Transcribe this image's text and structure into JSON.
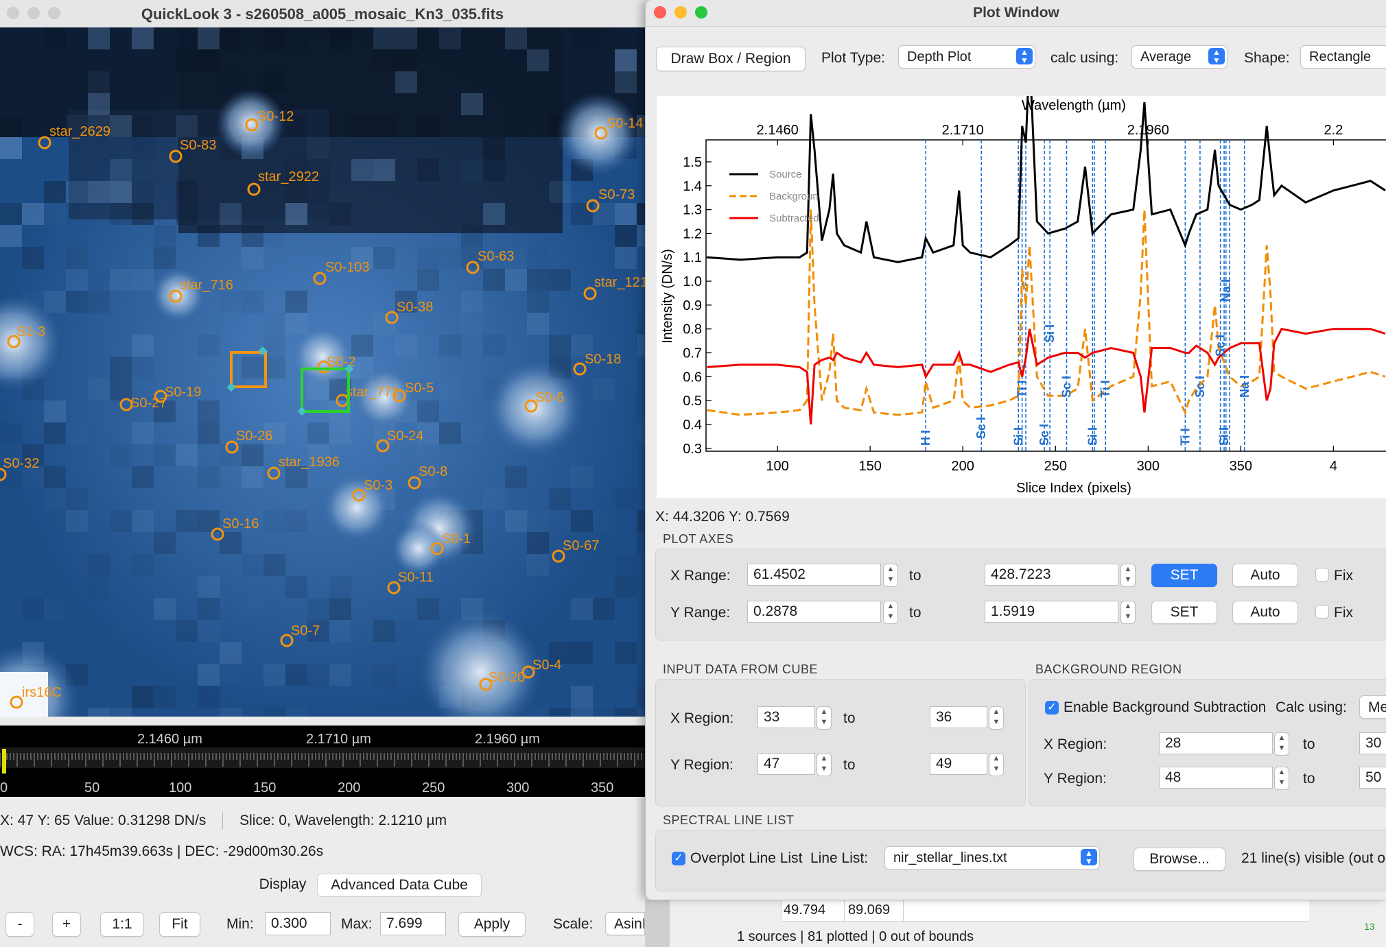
{
  "quicklook": {
    "title": "QuickLook 3 - s260508_a005_mosaic_Kn3_035.fits",
    "catalog": [
      {
        "label": "S0-12"
      },
      {
        "label": "star_2629"
      },
      {
        "label": "S0-83"
      },
      {
        "label": "star_2922"
      },
      {
        "label": "S0-14"
      },
      {
        "label": "S0-73"
      },
      {
        "label": "S0-63"
      },
      {
        "label": "S0-103"
      },
      {
        "label": "star_716"
      },
      {
        "label": "star_121"
      },
      {
        "label": "S0-38"
      },
      {
        "label": "S1-3"
      },
      {
        "label": "S0-2"
      },
      {
        "label": "S0-18"
      },
      {
        "label": "S0-27"
      },
      {
        "label": "S0-19"
      },
      {
        "label": "star_771"
      },
      {
        "label": "S0-5"
      },
      {
        "label": "S0-6"
      },
      {
        "label": "S0-26"
      },
      {
        "label": "S0-24"
      },
      {
        "label": "S0-32"
      },
      {
        "label": "star_1936"
      },
      {
        "label": "S0-8"
      },
      {
        "label": "S0-3"
      },
      {
        "label": "S0-16"
      },
      {
        "label": "S0-1"
      },
      {
        "label": "S0-67"
      },
      {
        "label": "S0-11"
      },
      {
        "label": "S0-7"
      },
      {
        "label": "S0-4"
      },
      {
        "label": "S0-20"
      },
      {
        "label": "irs16C"
      }
    ],
    "wavelength_strip": {
      "top_ticks": [
        "2.1460 µm",
        "2.1710 µm",
        "2.1960 µm"
      ],
      "bottom_ticks": [
        "0",
        "50",
        "100",
        "150",
        "200",
        "250",
        "300",
        "350"
      ]
    },
    "status": {
      "cursor": "X: 47  Y: 65  Value: 0.31298 DN/s",
      "slice": "Slice: 0, Wavelength: 2.1210 µm",
      "wcs": "WCS: RA: 17h45m39.663s  |  DEC: -29d00m30.26s"
    },
    "tabs": {
      "display": "Display",
      "advanced": "Advanced Data Cube"
    },
    "controls": {
      "minus": "-",
      "plus": "+",
      "one_to_one": "1:1",
      "fit": "Fit",
      "min_label": "Min:",
      "min_value": "0.300",
      "max_label": "Max:",
      "max_value": "7.699",
      "apply": "Apply",
      "scale_label": "Scale:",
      "scale_value": "AsinH"
    }
  },
  "background_window": {
    "table_cells": [
      "49.794",
      "89.069"
    ],
    "footer": "1 sources | 81 plotted | 0 out of bounds",
    "corner": "13"
  },
  "plot_window": {
    "title": "Plot Window",
    "toolbar": {
      "draw_box": "Draw Box / Region",
      "plot_type_label": "Plot Type:",
      "plot_type_value": "Depth Plot",
      "calc_label": "calc using:",
      "calc_value": "Average",
      "shape_label": "Shape:",
      "shape_value": "Rectangle"
    },
    "cursor_readout": "X: 44.3206   Y: 0.7569",
    "plot_axes": {
      "section": "PLOT AXES",
      "x_label": "X Range:",
      "x_min": "61.4502",
      "x_max": "428.7223",
      "y_label": "Y Range:",
      "y_min": "0.2878",
      "y_max": "1.5919",
      "to": "to",
      "set": "SET",
      "auto": "Auto",
      "fix": "Fix"
    },
    "input_data": {
      "section": "INPUT DATA FROM CUBE",
      "x_label": "X Region:",
      "x_from": "33",
      "x_to": "36",
      "y_label": "Y Region:",
      "y_from": "47",
      "y_to": "49",
      "to": "to"
    },
    "background_region": {
      "section": "BACKGROUND REGION",
      "enable": "Enable Background Subtraction",
      "calc_label": "Calc using:",
      "calc_value": "Me",
      "x_label": "X Region:",
      "x_from": "28",
      "x_to": "30",
      "y_label": "Y Region:",
      "y_from": "48",
      "y_to": "50",
      "to": "to"
    },
    "line_list": {
      "section": "SPECTRAL LINE LIST",
      "overplot": "Overplot Line List",
      "list_label": "Line List:",
      "list_value": "nir_stellar_lines.txt",
      "browse": "Browse...",
      "visible": "21 line(s) visible (out o"
    }
  },
  "chart_data": {
    "type": "line",
    "xlabel": "Slice Index (pixels)",
    "ylabel": "Intensity (DN/s)",
    "top_xlabel": "Wavelength (µm)",
    "xlim": [
      61.4502,
      428.7223
    ],
    "ylim": [
      0.2878,
      1.5919
    ],
    "x_ticks": [
      "100",
      "150",
      "200",
      "250",
      "300",
      "350",
      "4"
    ],
    "y_ticks": [
      "0.3",
      "0.4",
      "0.5",
      "0.6",
      "0.7",
      "0.8",
      "0.9",
      "1.0",
      "1.1",
      "1.2",
      "1.3",
      "1.4",
      "1.5"
    ],
    "top_ticks": [
      {
        "x": 100,
        "label": "2.1460"
      },
      {
        "x": 200,
        "label": "2.1710"
      },
      {
        "x": 300,
        "label": "2.1960"
      },
      {
        "x": 400,
        "label": "2.2"
      }
    ],
    "legend": [
      "Source",
      "Backgroun",
      "Subtracted"
    ],
    "colors": {
      "Source": "#000000",
      "Background": "#f28c00",
      "Subtracted": "#ee0000",
      "Lines": "#1f6fd1"
    },
    "series": [
      {
        "name": "Source",
        "x": [
          62,
          80,
          100,
          112,
          116,
          118,
          120,
          124,
          128,
          130,
          132,
          136,
          145,
          148,
          152,
          165,
          178,
          180,
          184,
          195,
          198,
          200,
          204,
          215,
          225,
          230,
          232,
          234,
          236,
          240,
          246,
          255,
          262,
          266,
          270,
          280,
          292,
          296,
          298,
          302,
          312,
          320,
          322,
          326,
          332,
          336,
          338,
          344,
          350,
          356,
          360,
          364,
          366,
          368,
          372,
          385,
          400,
          410,
          420,
          428
        ],
        "y": [
          1.1,
          1.09,
          1.1,
          1.1,
          1.12,
          1.7,
          1.55,
          1.17,
          1.3,
          1.45,
          1.2,
          1.15,
          1.12,
          1.25,
          1.1,
          1.08,
          1.1,
          1.18,
          1.12,
          1.15,
          1.38,
          1.15,
          1.12,
          1.1,
          1.15,
          1.18,
          1.65,
          1.58,
          1.95,
          1.25,
          1.2,
          1.22,
          1.25,
          1.48,
          1.2,
          1.28,
          1.3,
          1.55,
          1.75,
          1.28,
          1.3,
          1.15,
          1.2,
          1.28,
          1.3,
          1.55,
          1.4,
          1.32,
          1.3,
          1.32,
          1.34,
          1.65,
          1.5,
          1.36,
          1.4,
          1.33,
          1.38,
          1.4,
          1.42,
          1.38
        ]
      },
      {
        "name": "Background",
        "x": [
          62,
          80,
          100,
          112,
          116,
          118,
          120,
          124,
          128,
          130,
          132,
          136,
          145,
          148,
          152,
          165,
          178,
          180,
          184,
          195,
          198,
          200,
          204,
          215,
          225,
          230,
          232,
          234,
          236,
          240,
          246,
          255,
          262,
          266,
          270,
          280,
          292,
          296,
          298,
          302,
          312,
          320,
          322,
          326,
          332,
          336,
          338,
          344,
          350,
          356,
          360,
          364,
          366,
          368,
          372,
          385,
          400,
          410,
          420,
          428
        ],
        "y": [
          0.46,
          0.44,
          0.45,
          0.46,
          0.5,
          1.3,
          0.9,
          0.5,
          0.62,
          0.78,
          0.5,
          0.47,
          0.46,
          0.55,
          0.45,
          0.44,
          0.45,
          0.58,
          0.47,
          0.5,
          0.68,
          0.5,
          0.47,
          0.48,
          0.5,
          0.52,
          1.05,
          0.9,
          1.15,
          0.6,
          0.52,
          0.52,
          0.55,
          0.8,
          0.5,
          0.56,
          0.6,
          0.95,
          1.3,
          0.56,
          0.58,
          0.45,
          0.5,
          0.55,
          0.6,
          0.9,
          0.72,
          0.6,
          0.56,
          0.58,
          0.6,
          1.15,
          0.95,
          0.62,
          0.6,
          0.55,
          0.58,
          0.6,
          0.62,
          0.6
        ]
      },
      {
        "name": "Subtracted",
        "x": [
          62,
          80,
          100,
          112,
          116,
          118,
          120,
          124,
          128,
          130,
          132,
          136,
          145,
          148,
          152,
          165,
          178,
          180,
          184,
          195,
          198,
          200,
          204,
          215,
          225,
          230,
          232,
          234,
          236,
          240,
          246,
          255,
          262,
          266,
          270,
          280,
          292,
          296,
          298,
          302,
          312,
          320,
          322,
          326,
          332,
          336,
          338,
          344,
          350,
          356,
          360,
          364,
          366,
          368,
          372,
          385,
          400,
          410,
          420,
          428
        ],
        "y": [
          0.64,
          0.65,
          0.65,
          0.64,
          0.62,
          0.4,
          0.65,
          0.67,
          0.68,
          0.67,
          0.7,
          0.68,
          0.66,
          0.7,
          0.65,
          0.64,
          0.65,
          0.6,
          0.65,
          0.65,
          0.7,
          0.65,
          0.65,
          0.62,
          0.65,
          0.66,
          0.6,
          0.68,
          0.8,
          0.65,
          0.68,
          0.7,
          0.7,
          0.68,
          0.7,
          0.72,
          0.7,
          0.6,
          0.45,
          0.72,
          0.72,
          0.7,
          0.7,
          0.73,
          0.7,
          0.65,
          0.68,
          0.72,
          0.74,
          0.74,
          0.74,
          0.5,
          0.55,
          0.74,
          0.8,
          0.78,
          0.8,
          0.8,
          0.8,
          0.78
        ]
      }
    ],
    "lines": [
      {
        "x": 180,
        "label": "H I"
      },
      {
        "x": 210,
        "label": "Sc I"
      },
      {
        "x": 230,
        "label": "Si I"
      },
      {
        "x": 232,
        "label": "Ti I"
      },
      {
        "x": 234,
        "label": ""
      },
      {
        "x": 244,
        "label": "Sc I"
      },
      {
        "x": 247,
        "label": "Si I"
      },
      {
        "x": 256,
        "label": "Sc I"
      },
      {
        "x": 270,
        "label": "Si I"
      },
      {
        "x": 271,
        "label": ""
      },
      {
        "x": 277,
        "label": "Ti I"
      },
      {
        "x": 320,
        "label": "Ti I"
      },
      {
        "x": 328,
        "label": "Sc I"
      },
      {
        "x": 339,
        "label": "Sc I"
      },
      {
        "x": 341,
        "label": "Si I"
      },
      {
        "x": 342,
        "label": "Na I"
      },
      {
        "x": 344,
        "label": ""
      },
      {
        "x": 352,
        "label": "Na I"
      }
    ]
  }
}
